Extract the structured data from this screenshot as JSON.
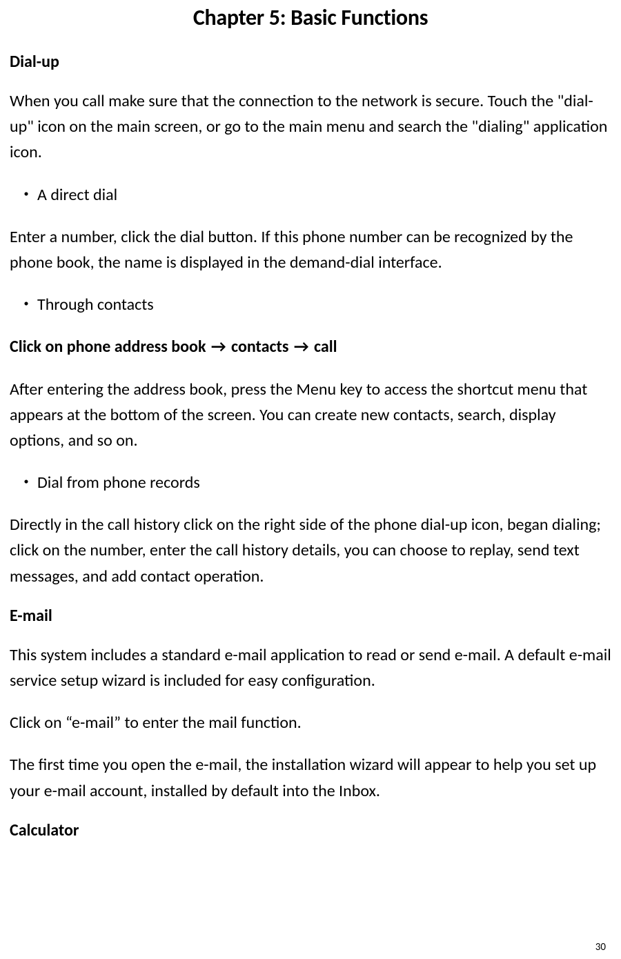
{
  "chapter_title": "Chapter 5: Basic Functions",
  "sections": {
    "dialup": {
      "heading": "Dial-up",
      "intro": "When you call make sure that the connection to the network is secure. Touch the \"dial-up\" icon on the main screen, or go to the main menu and search the \"dialing\" application icon.",
      "bullets": {
        "direct_dial": "A direct dial",
        "through_contacts": "Through contacts",
        "from_records": "Dial from phone records"
      },
      "direct_dial_para": "Enter a number, click the dial button. If this phone number can be recognized by the phone book, the name is displayed in the demand-dial interface.",
      "nav_path": {
        "prefix": "Click on phone address book ",
        "arrow": "→",
        "mid1": " contacts ",
        "mid2": " call"
      },
      "after_addressbook": "After entering the address book, press the Menu key to access the shortcut menu that appears at the bottom of the screen. You can create new contacts, search, display options, and so on.",
      "records_para": "Directly in the call history click on the right side of the phone dial-up icon, began dialing; click on the number, enter the call history details, you can choose to replay, send text messages, and add contact operation."
    },
    "email": {
      "heading": "E-mail",
      "para1": "This system includes a standard e-mail application to read or send e-mail. A default e-mail service setup wizard is included for easy configuration.",
      "para2": "Click on “e-mail” to enter the mail function.",
      "para3": "The first time you open the e-mail, the installation wizard will appear to help you set up your e-mail account, installed by default into the Inbox."
    },
    "calculator": {
      "heading": "Calculator"
    }
  },
  "bullet_glyph": "・",
  "page_number": "30"
}
